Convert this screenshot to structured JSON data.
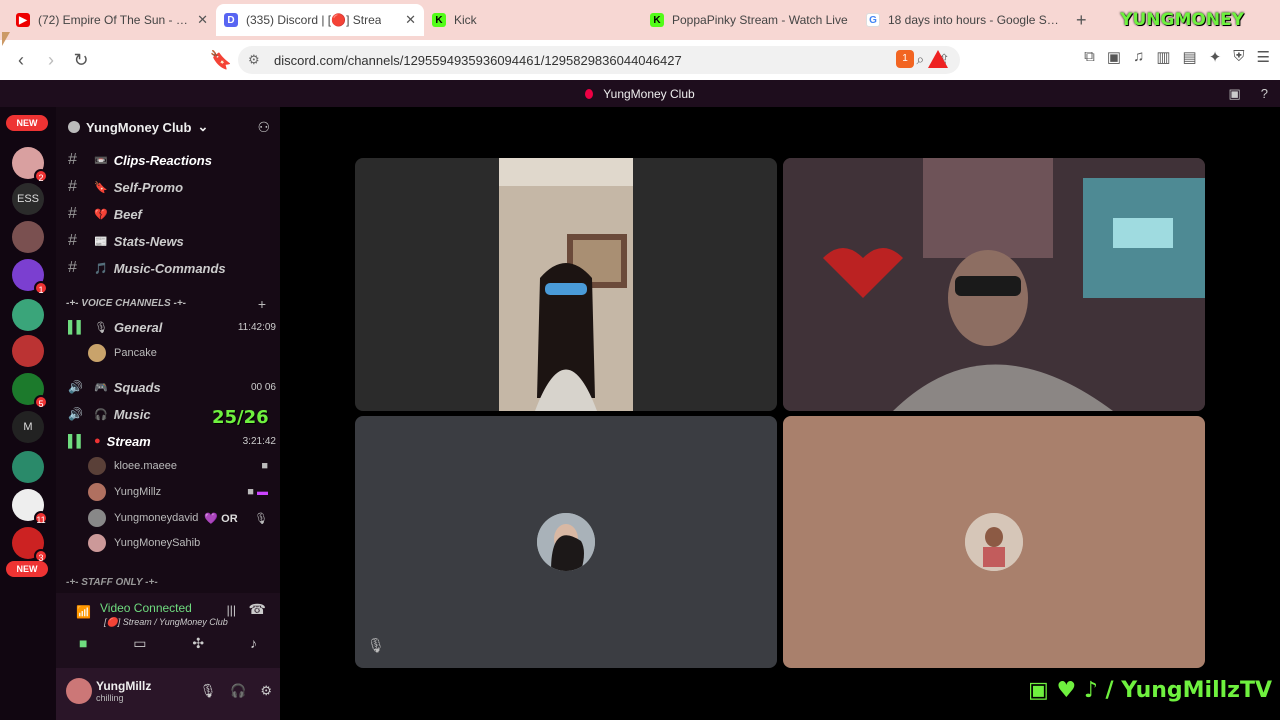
{
  "browser": {
    "tabs": [
      {
        "title": "(72) Empire Of The Sun - Wal",
        "active": false
      },
      {
        "title": "(335) Discord | [🔴] Strea",
        "active": true
      },
      {
        "title": "Kick",
        "active": false
      },
      {
        "title": "PoppaPinky Stream - Watch Live",
        "active": false
      },
      {
        "title": "18 days into hours - Google Searc",
        "active": false
      }
    ],
    "url": "discord.com/channels/1295594935936094461/1295829836044046427",
    "brave_badge": "1",
    "rewards_badge": "1"
  },
  "overlay": {
    "logo_text": "YUNGMONEY",
    "socials": "/ YungMillzTV",
    "voice_count": "25/26"
  },
  "discord": {
    "top_title": "YungMoney Club",
    "server_rail": {
      "new_top": "NEW",
      "new_bottom": "NEW",
      "ess": "ESS",
      "badges": [
        "2",
        "1",
        "5",
        "11",
        "3"
      ]
    },
    "server_name": "YungMoney Club",
    "text_channels": [
      {
        "icon": "📼",
        "name": "Clips-Reactions"
      },
      {
        "icon": "🔖",
        "name": "Self-Promo"
      },
      {
        "icon": "💔",
        "name": "Beef"
      },
      {
        "icon": "📰",
        "name": "Stats-News"
      },
      {
        "icon": "🎵",
        "name": "Music-Commands"
      }
    ],
    "voice_category": "-+- VOICE CHANNELS -+-",
    "voice_channels": {
      "general": {
        "name": "General",
        "timer": "11:42:09"
      },
      "general_user": "Pancake",
      "squads": {
        "name": "Squads",
        "timer": "00 06"
      },
      "music": {
        "name": "Music"
      },
      "stream": {
        "name": "Stream",
        "timer": "3:21:42"
      }
    },
    "stream_users": [
      {
        "name": "kloee.maeee"
      },
      {
        "name": "YungMillz"
      },
      {
        "name": "Yungmoneydavid",
        "tag": "💜 OR"
      },
      {
        "name": "YungMoneySahib"
      }
    ],
    "staff_category": "-+- STAFF ONLY -+-",
    "voice_panel": {
      "status": "Video Connected",
      "sub": "[🔴] Stream / YungMoney Club"
    },
    "user_panel": {
      "name": "YungMillz",
      "status": "chilling"
    }
  }
}
